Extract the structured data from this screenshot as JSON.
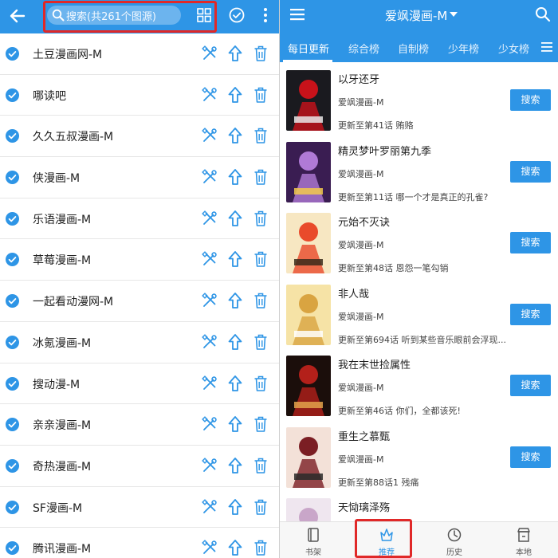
{
  "left_panel": {
    "search_placeholder": "搜索(共261个图源)",
    "sources": [
      "土豆漫画网-M",
      "哪读吧",
      "久久五叔漫画-M",
      "侠漫画-M",
      "乐语漫画-M",
      "草莓漫画-M",
      "一起看动漫网-M",
      "冰氪漫画-M",
      "搜动漫-M",
      "亲亲漫画-M",
      "奇热漫画-M",
      "SF漫画-M",
      "腾讯漫画-M"
    ]
  },
  "right_panel": {
    "title": "爱飒漫画-M",
    "tabs": [
      "每日更新",
      "综合榜",
      "自制榜",
      "少年榜",
      "少女榜"
    ],
    "active_tab": 0,
    "search_button_label": "搜索",
    "comics": [
      {
        "title": "以牙还牙",
        "source": "爱飒漫画-M",
        "update": "更新至第41话 贿赂"
      },
      {
        "title": "精灵梦叶罗丽第九季",
        "source": "爱飒漫画-M",
        "update": "更新至第11话 哪一个才是真正的孔雀?"
      },
      {
        "title": "元始不灭诀",
        "source": "爱飒漫画-M",
        "update": "更新至第48话 恩怨一笔勾销"
      },
      {
        "title": "非人哉",
        "source": "爱飒漫画-M",
        "update": "更新至第694话 听到某些音乐眼前会浮现..."
      },
      {
        "title": "我在末世捡属性",
        "source": "爱飒漫画-M",
        "update": "更新至第46话 你们，全都该死!"
      },
      {
        "title": "重生之慕甄",
        "source": "爱飒漫画-M",
        "update": "更新至第88话1 残痛"
      },
      {
        "title": "天恸璃泽殇",
        "source": "",
        "update": ""
      }
    ],
    "bottom_nav": [
      {
        "label": "书架",
        "icon": "bookshelf-icon"
      },
      {
        "label": "推荐",
        "icon": "recommend-icon"
      },
      {
        "label": "历史",
        "icon": "history-icon"
      },
      {
        "label": "本地",
        "icon": "local-store-icon"
      }
    ],
    "active_nav": 1
  },
  "colors": {
    "primary": "#2e95e6",
    "highlight": "#e02828"
  }
}
